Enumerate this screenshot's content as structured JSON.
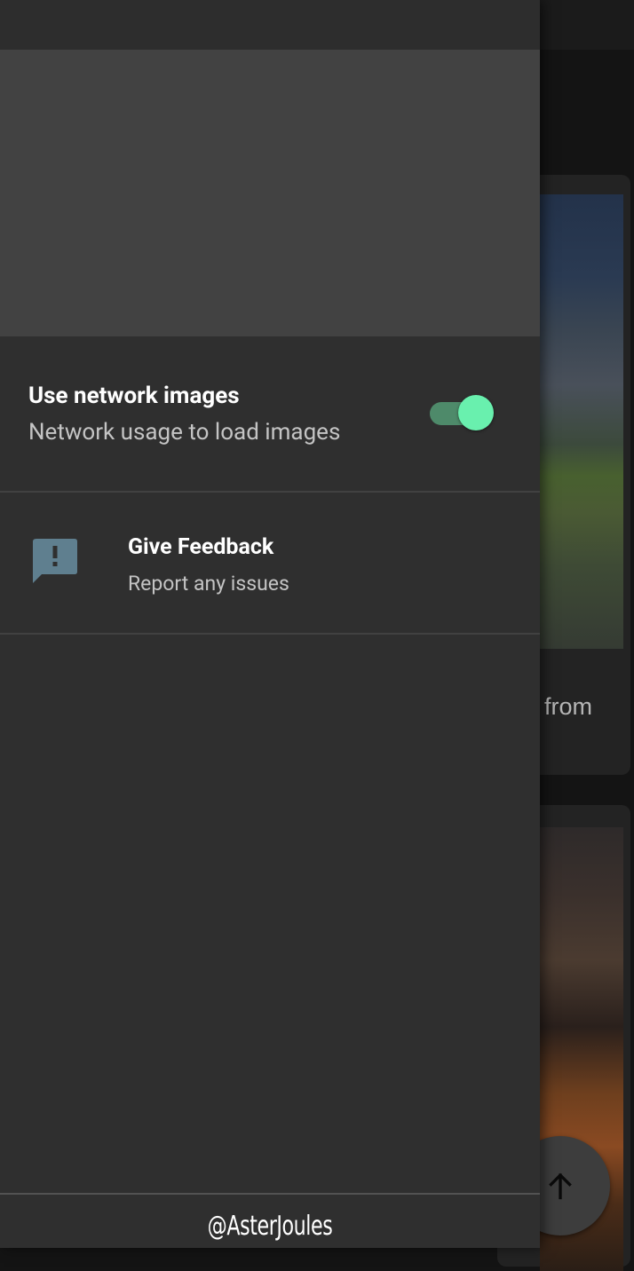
{
  "background": {
    "card_text": "from",
    "fab_icon": "arrow-up-icon"
  },
  "drawer": {
    "network_images": {
      "title": "Use network images",
      "subtitle": "Network usage to load images",
      "enabled": true
    },
    "feedback": {
      "icon": "feedback-icon",
      "title": "Give Feedback",
      "subtitle": "Report any issues"
    },
    "footer": {
      "handle": "@AsterJoules"
    }
  },
  "colors": {
    "accent": "#69f0ae",
    "drawer_bg": "#2f2f2f",
    "header_bg": "#424242",
    "feedback_icon": "#5f7f8f"
  }
}
